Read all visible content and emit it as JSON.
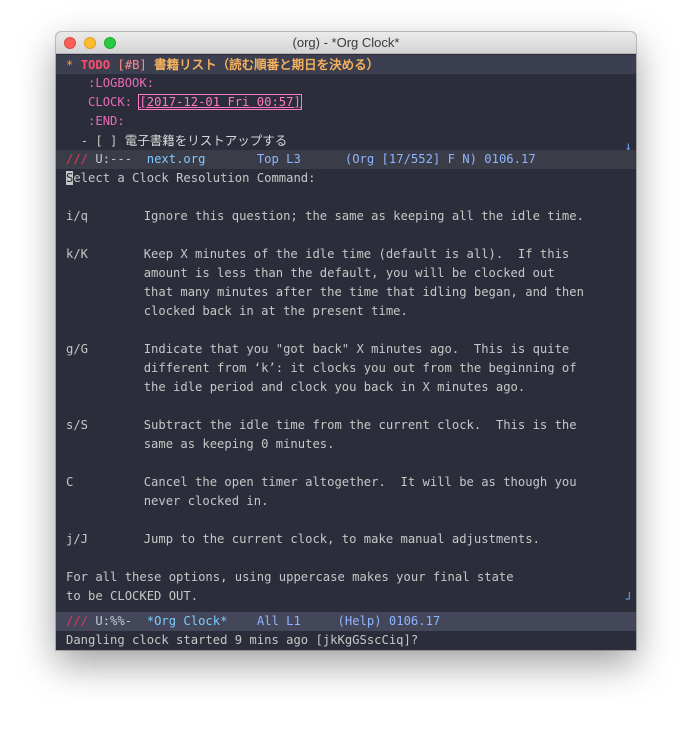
{
  "window": {
    "title": "(org) - *Org Clock*"
  },
  "org_buffer": {
    "heading": {
      "stars": "*",
      "todo": "TODO",
      "priority": "[#B]",
      "title": "書籍リスト（読む順番と期日を決める）"
    },
    "logbook_start": ":LOGBOOK:",
    "clock_label": "CLOCK:",
    "clock_timestamp": "[2017-12-01 Fri 00:57]",
    "logbook_end": ":END:",
    "checkbox_item": {
      "prefix": "- [ ]",
      "text": "電子書籍をリストアップする"
    }
  },
  "mode_line_top": {
    "marker": "///",
    "state": "U:---",
    "buffer": "next.org",
    "position": "Top L3",
    "modes": "(Org [17/552] F N)",
    "version": "0106.17"
  },
  "clock_buffer": {
    "intro_first_char": "S",
    "intro_rest": "elect a Clock Resolution Command:",
    "options": [
      {
        "key": "i/q",
        "lines": [
          "Ignore this question; the same as keeping all the idle time."
        ]
      },
      {
        "key": "k/K",
        "lines": [
          "Keep X minutes of the idle time (default is all).  If this",
          "amount is less than the default, you will be clocked out",
          "that many minutes after the time that idling began, and then",
          "clocked back in at the present time."
        ]
      },
      {
        "key": "g/G",
        "lines": [
          "Indicate that you \"got back\" X minutes ago.  This is quite",
          "different from ‘k’: it clocks you out from the beginning of",
          "the idle period and clock you back in X minutes ago."
        ]
      },
      {
        "key": "s/S",
        "lines": [
          "Subtract the idle time from the current clock.  This is the",
          "same as keeping 0 minutes."
        ]
      },
      {
        "key": "C",
        "lines": [
          "Cancel the open timer altogether.  It will be as though you",
          "never clocked in."
        ]
      },
      {
        "key": "j/J",
        "lines": [
          "Jump to the current clock, to make manual adjustments."
        ]
      }
    ],
    "footer": [
      "For all these options, using uppercase makes your final state",
      "to be CLOCKED OUT."
    ]
  },
  "mode_line_bottom": {
    "marker": "///",
    "state": "U:%%-",
    "buffer": "*Org Clock*",
    "position": "All L1",
    "modes": "(Help)",
    "version": "0106.17"
  },
  "minibuffer": {
    "prompt": "Dangling clock started 9 mins ago [jkKgGSscCiq]?"
  }
}
